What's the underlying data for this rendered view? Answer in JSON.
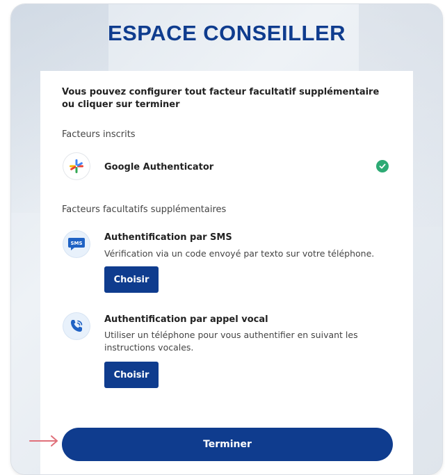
{
  "header": {
    "title": "ESPACE CONSEILLER"
  },
  "intro": "Vous pouvez configurer tout facteur facultatif supplémentaire ou cliquer sur terminer",
  "enrolled": {
    "label": "Facteurs inscrits",
    "factor": {
      "name": "Google Authenticator",
      "icon": "google-authenticator-icon",
      "status": "check-icon"
    }
  },
  "optional": {
    "label": "Facteurs facultatifs supplémentaires",
    "factors": [
      {
        "title": "Authentification par SMS",
        "description": "Vérification via un code envoyé par texto sur votre téléphone.",
        "button": "Choisir",
        "icon": "sms-icon",
        "icon_text": "SMS"
      },
      {
        "title": "Authentification par appel vocal",
        "description": "Utiliser un téléphone pour vous authentifier en suivant les instructions vocales.",
        "button": "Choisir",
        "icon": "phone-call-icon"
      }
    ]
  },
  "finish_button": "Terminer",
  "colors": {
    "primary": "#0f3c8e",
    "success": "#2daa74",
    "arrow": "#e0707a"
  }
}
